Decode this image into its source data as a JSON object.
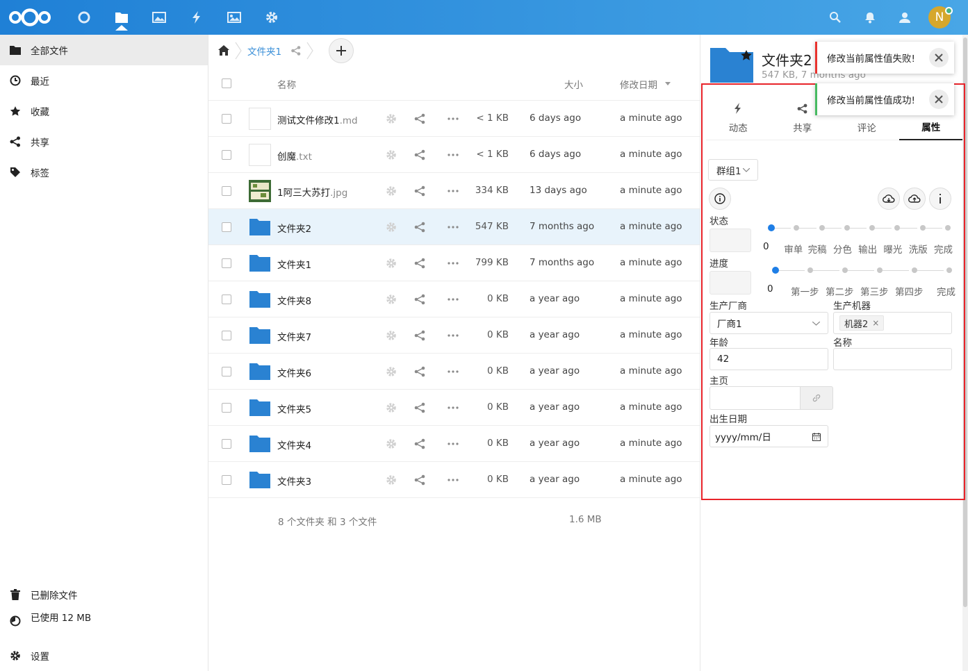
{
  "header": {
    "apps": [
      "dashboard-icon",
      "files-icon",
      "photos-icon",
      "activity-icon",
      "gallery-icon",
      "settings-app-icon"
    ],
    "avatar_letter": "N"
  },
  "sidebar": {
    "items": [
      {
        "label": "全部文件",
        "icon": "folder-icon"
      },
      {
        "label": "最近",
        "icon": "clock-icon"
      },
      {
        "label": "收藏",
        "icon": "star-icon"
      },
      {
        "label": "共享",
        "icon": "share-icon"
      },
      {
        "label": "标签",
        "icon": "tag-icon"
      }
    ],
    "deleted": "已删除文件",
    "quota": "已使用 12 MB",
    "settings": "设置"
  },
  "breadcrumb": {
    "folder": "文件夹1"
  },
  "list": {
    "headers": {
      "name": "名称",
      "size": "大小",
      "modified": "修改日期"
    },
    "rows": [
      {
        "name": "测试文件修改1",
        "ext": ".md",
        "type": "doc",
        "size": "< 1 KB",
        "modified": "6 days ago",
        "changed": "a minute ago"
      },
      {
        "name": "创魔",
        "ext": ".txt",
        "type": "doc",
        "size": "< 1 KB",
        "modified": "6 days ago",
        "changed": "a minute ago"
      },
      {
        "name": "1阿三大苏打",
        "ext": ".jpg",
        "type": "image",
        "size": "334 KB",
        "modified": "13 days ago",
        "changed": "a minute ago"
      },
      {
        "name": "文件夹2",
        "ext": "",
        "type": "folder",
        "size": "547 KB",
        "modified": "7 months ago",
        "changed": "a minute ago"
      },
      {
        "name": "文件夹1",
        "ext": "",
        "type": "folder",
        "size": "799 KB",
        "modified": "7 months ago",
        "changed": "a minute ago"
      },
      {
        "name": "文件夹8",
        "ext": "",
        "type": "folder",
        "size": "0 KB",
        "modified": "a year ago",
        "changed": "a minute ago"
      },
      {
        "name": "文件夹7",
        "ext": "",
        "type": "folder",
        "size": "0 KB",
        "modified": "a year ago",
        "changed": "a minute ago"
      },
      {
        "name": "文件夹6",
        "ext": "",
        "type": "folder",
        "size": "0 KB",
        "modified": "a year ago",
        "changed": "a minute ago"
      },
      {
        "name": "文件夹5",
        "ext": "",
        "type": "folder",
        "size": "0 KB",
        "modified": "a year ago",
        "changed": "a minute ago"
      },
      {
        "name": "文件夹4",
        "ext": "",
        "type": "folder",
        "size": "0 KB",
        "modified": "a year ago",
        "changed": "a minute ago"
      },
      {
        "name": "文件夹3",
        "ext": "",
        "type": "folder",
        "size": "0 KB",
        "modified": "a year ago",
        "changed": "a minute ago"
      }
    ],
    "summary_count": "8 个文件夹 和 3 个文件",
    "summary_size": "1.6 MB"
  },
  "panel": {
    "title": "文件夹2",
    "subtitle": "547 KB, 7 months ago",
    "tabs": [
      "动态",
      "共享",
      "评论",
      "属性"
    ],
    "group_select": "群组1",
    "status_label": "状态",
    "status_value": "0",
    "status_steps": [
      "审单",
      "完稿",
      "分色",
      "输出",
      "曝光",
      "洗版",
      "完成"
    ],
    "progress_label": "进度",
    "progress_value": "0",
    "progress_steps": [
      "第一步",
      "第二步",
      "第三步",
      "第四步",
      "完成"
    ],
    "manufacturer_label": "生产厂商",
    "manufacturer_value": "厂商1",
    "machine_label": "生产机器",
    "machine_tag": "机器2",
    "age_label": "年龄",
    "age_value": "42",
    "name_label": "名称",
    "homepage_label": "主页",
    "birthday_label": "出生日期",
    "birthday_placeholder": "yyyy/mm/日"
  },
  "toasts": {
    "error": "修改当前属性值失败!",
    "success": "修改当前属性值成功!"
  },
  "colors": {
    "accent": "#1e7ee6",
    "error": "#e9322d",
    "success": "#46ba61",
    "highlight": "#e8232a"
  }
}
